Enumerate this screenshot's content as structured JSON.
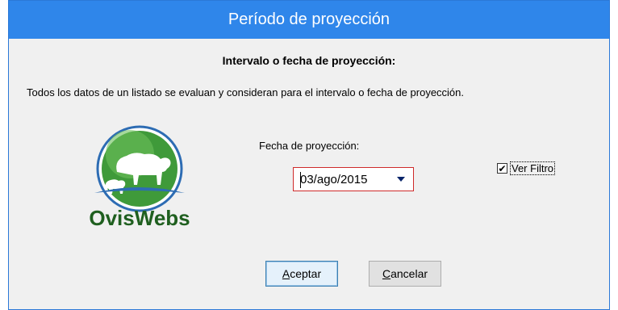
{
  "window": {
    "title": "Período de proyección"
  },
  "heading": "Intervalo o fecha de proyección:",
  "description": "Todos los datos de un listado se evaluan y consideran para el intervalo o fecha de proyección.",
  "logo": {
    "text": "OvisWebs",
    "colors": {
      "green": "#3f9a3a",
      "dark_green": "#1f5f1f",
      "blue": "#2d6cb3"
    }
  },
  "fecha": {
    "label": "Fecha de proyección:",
    "value": "03/ago/2015"
  },
  "filtro": {
    "label": "Ver Filtro",
    "checked": true
  },
  "buttons": {
    "aceptar_first": "A",
    "aceptar_rest": "ceptar",
    "cancelar_first": "C",
    "cancelar_rest": "ancelar"
  },
  "colors": {
    "titlebar": "#2f86ea",
    "window_bg": "#f0f0f0",
    "combo_border": "#cf2a2a"
  }
}
